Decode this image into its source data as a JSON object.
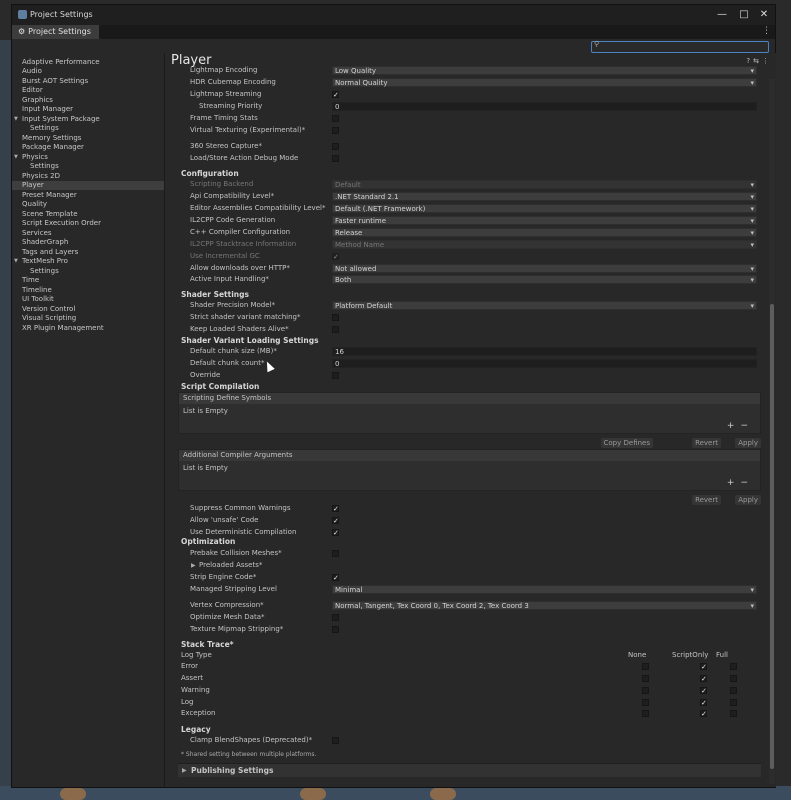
{
  "window": {
    "title": "Project Settings",
    "tab": "Project Settings"
  },
  "sidebar": {
    "items": [
      {
        "label": "Adaptive Performance"
      },
      {
        "label": "Audio"
      },
      {
        "label": "Burst AOT Settings"
      },
      {
        "label": "Editor"
      },
      {
        "label": "Graphics"
      },
      {
        "label": "Input Manager"
      },
      {
        "label": "Input System Package",
        "expanded": true
      },
      {
        "label": "Settings",
        "child": true
      },
      {
        "label": "Memory Settings"
      },
      {
        "label": "Package Manager"
      },
      {
        "label": "Physics",
        "expanded": true
      },
      {
        "label": "Settings",
        "child": true
      },
      {
        "label": "Physics 2D"
      },
      {
        "label": "Player",
        "selected": true
      },
      {
        "label": "Preset Manager"
      },
      {
        "label": "Quality"
      },
      {
        "label": "Scene Template"
      },
      {
        "label": "Script Execution Order"
      },
      {
        "label": "Services"
      },
      {
        "label": "ShaderGraph"
      },
      {
        "label": "Tags and Layers"
      },
      {
        "label": "TextMesh Pro",
        "expanded": true
      },
      {
        "label": "Settings",
        "child": true
      },
      {
        "label": "Time"
      },
      {
        "label": "Timeline"
      },
      {
        "label": "UI Toolkit"
      },
      {
        "label": "Version Control"
      },
      {
        "label": "Visual Scripting"
      },
      {
        "label": "XR Plugin Management"
      }
    ]
  },
  "page": {
    "title": "Player"
  },
  "rows_top": [
    {
      "label": "Lightmap Encoding",
      "type": "dropdown",
      "value": "Low Quality"
    },
    {
      "label": "HDR Cubemap Encoding",
      "type": "dropdown",
      "value": "Normal Quality"
    },
    {
      "label": "Lightmap Streaming",
      "type": "checkbox",
      "checked": true
    },
    {
      "label": "Streaming Priority",
      "type": "input",
      "value": "0",
      "sub": true
    },
    {
      "label": "Frame Timing Stats",
      "type": "checkbox",
      "checked": false
    },
    {
      "label": "Virtual Texturing (Experimental)*",
      "type": "checkbox",
      "checked": false
    },
    {
      "label": "360 Stereo Capture*",
      "type": "checkbox",
      "checked": false
    },
    {
      "label": "Load/Store Action Debug Mode",
      "type": "checkbox",
      "checked": false
    }
  ],
  "configuration": {
    "heading": "Configuration",
    "rows": [
      {
        "label": "Scripting Backend",
        "type": "dropdown",
        "value": "Default",
        "disabled": true
      },
      {
        "label": "Api Compatibility Level*",
        "type": "dropdown",
        "value": ".NET Standard 2.1"
      },
      {
        "label": "Editor Assemblies Compatibility Level*",
        "type": "dropdown",
        "value": "Default (.NET Framework)"
      },
      {
        "label": "IL2CPP Code Generation",
        "type": "dropdown",
        "value": "Faster runtime"
      },
      {
        "label": "C++ Compiler Configuration",
        "type": "dropdown",
        "value": "Release"
      },
      {
        "label": "IL2CPP Stacktrace Information",
        "type": "dropdown",
        "value": "Method Name",
        "disabled": true
      },
      {
        "label": "Use Incremental GC",
        "type": "checkbox",
        "checked": true,
        "disabled": true
      },
      {
        "label": "Allow downloads over HTTP*",
        "type": "dropdown",
        "value": "Not allowed"
      },
      {
        "label": "Active Input Handling*",
        "type": "dropdown",
        "value": "Both"
      }
    ]
  },
  "shader_settings": {
    "heading": "Shader Settings",
    "rows": [
      {
        "label": "Shader Precision Model*",
        "type": "dropdown",
        "value": "Platform Default"
      },
      {
        "label": "Strict shader variant matching*",
        "type": "checkbox",
        "checked": false
      },
      {
        "label": "Keep Loaded Shaders Alive*",
        "type": "checkbox",
        "checked": false
      }
    ]
  },
  "shader_variant": {
    "heading": "Shader Variant Loading Settings",
    "rows": [
      {
        "label": "Default chunk size (MB)*",
        "type": "input",
        "value": "16"
      },
      {
        "label": "Default chunk count*",
        "type": "input",
        "value": "0"
      },
      {
        "label": "Override",
        "type": "checkbox",
        "checked": false
      }
    ]
  },
  "script_compilation": {
    "heading": "Script Compilation",
    "define_symbols": {
      "title": "Scripting Define Symbols",
      "empty": "List is Empty",
      "buttons": [
        "Copy Defines",
        "Revert",
        "Apply"
      ]
    },
    "compiler_args": {
      "title": "Additional Compiler Arguments",
      "empty": "List is Empty",
      "buttons": [
        "Revert",
        "Apply"
      ]
    },
    "list_controls": {
      "add": "+",
      "remove": "−"
    },
    "rows": [
      {
        "label": "Suppress Common Warnings",
        "type": "checkbox",
        "checked": true
      },
      {
        "label": "Allow 'unsafe' Code",
        "type": "checkbox",
        "checked": true
      },
      {
        "label": "Use Deterministic Compilation",
        "type": "checkbox",
        "checked": true
      }
    ]
  },
  "optimization": {
    "heading": "Optimization",
    "rows": [
      {
        "label": "Prebake Collision Meshes*",
        "type": "checkbox",
        "checked": false
      },
      {
        "label": "Preloaded Assets*",
        "type": "foldout"
      },
      {
        "label": "Strip Engine Code*",
        "type": "checkbox",
        "checked": true
      },
      {
        "label": "Managed Stripping Level",
        "type": "dropdown",
        "value": "Minimal"
      },
      {
        "label": "Vertex Compression*",
        "type": "dropdown",
        "value": "Normal, Tangent, Tex Coord 0, Tex Coord 2, Tex Coord 3"
      },
      {
        "label": "Optimize Mesh Data*",
        "type": "checkbox",
        "checked": false
      },
      {
        "label": "Texture Mipmap Stripping*",
        "type": "checkbox",
        "checked": false
      }
    ]
  },
  "stack_trace": {
    "heading": "Stack Trace*",
    "col_label": "Log Type",
    "columns": [
      "None",
      "ScriptOnly",
      "Full"
    ],
    "rows": [
      {
        "label": "Error",
        "selected": 1
      },
      {
        "label": "Assert",
        "selected": 1
      },
      {
        "label": "Warning",
        "selected": 1
      },
      {
        "label": "Log",
        "selected": 1
      },
      {
        "label": "Exception",
        "selected": 1
      }
    ]
  },
  "legacy": {
    "heading": "Legacy",
    "rows": [
      {
        "label": "Clamp BlendShapes (Deprecated)*",
        "type": "checkbox",
        "checked": false
      }
    ]
  },
  "footnote": "* Shared setting between multiple platforms.",
  "publishing": {
    "label": "Publishing Settings"
  }
}
